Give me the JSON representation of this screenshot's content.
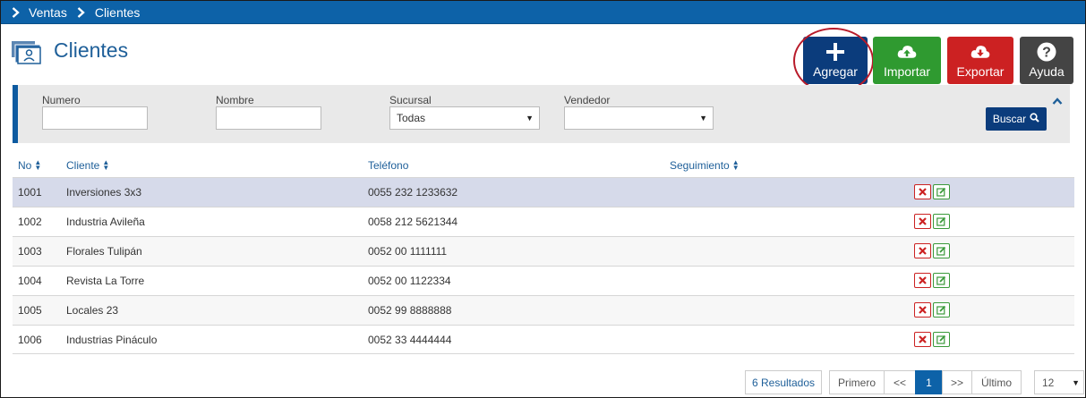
{
  "breadcrumb": {
    "items": [
      "Ventas",
      "Clientes"
    ]
  },
  "page": {
    "title": "Clientes"
  },
  "actions": {
    "agregar": "Agregar",
    "importar": "Importar",
    "exportar": "Exportar",
    "ayuda": "Ayuda"
  },
  "filters": {
    "numero_label": "Numero",
    "numero_value": "",
    "nombre_label": "Nombre",
    "nombre_value": "",
    "sucursal_label": "Sucursal",
    "sucursal_value": "Todas",
    "vendedor_label": "Vendedor",
    "vendedor_value": "",
    "buscar_label": "Buscar"
  },
  "table": {
    "headers": {
      "no": "No",
      "cliente": "Cliente",
      "telefono": "Teléfono",
      "seguimiento": "Seguimiento"
    },
    "rows": [
      {
        "no": "1001",
        "cliente": "Inversiones 3x3",
        "telefono": "0055 232 1233632"
      },
      {
        "no": "1002",
        "cliente": "Industria Avileña",
        "telefono": "0058 212 5621344"
      },
      {
        "no": "1003",
        "cliente": "Florales Tulipán",
        "telefono": "0052 00 1111111"
      },
      {
        "no": "1004",
        "cliente": "Revista La Torre",
        "telefono": "0052 00 1122334"
      },
      {
        "no": "1005",
        "cliente": "Locales 23",
        "telefono": "0052 99 8888888"
      },
      {
        "no": "1006",
        "cliente": "Industrias Pináculo",
        "telefono": "0052 33 4444444"
      }
    ]
  },
  "pagination": {
    "results": "6 Resultados",
    "first": "Primero",
    "prev": "<<",
    "current": "1",
    "next": ">>",
    "last": "Último",
    "page_size": "12"
  },
  "colors": {
    "topbar": "#0d62a8",
    "agregar": "#0b3c7c",
    "importar": "#2f9a30",
    "exportar": "#cc2122",
    "ayuda": "#444444"
  }
}
